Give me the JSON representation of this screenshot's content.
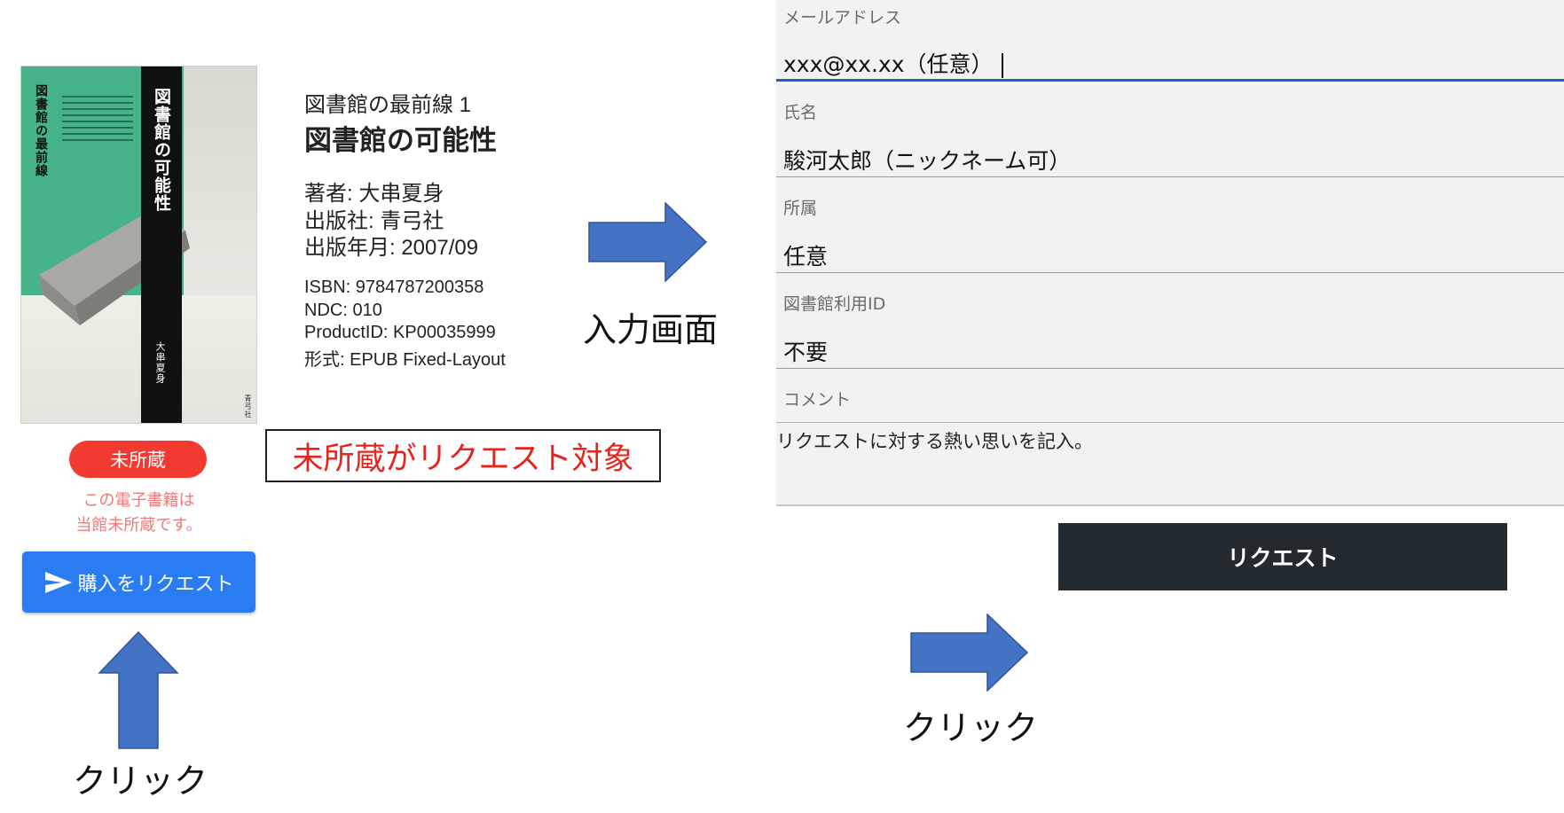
{
  "book": {
    "cover_title": "図書館の可能性",
    "cover_series": "図書館の最前線",
    "cover_author": "大串夏身",
    "cover_publisher": "青弓社",
    "series": "図書館の最前線 1",
    "title": "図書館の可能性",
    "author": "著者: 大串夏身",
    "publisher": "出版社: 青弓社",
    "pub_date": "出版年月: 2007/09",
    "isbn": "ISBN: 9784787200358",
    "ndc": "NDC: 010",
    "product_id": "ProductID: KP00035999",
    "format": "形式: EPUB Fixed-Layout"
  },
  "status": {
    "badge": "未所蔵",
    "note_line1": "この電子書籍は",
    "note_line2": "当館未所蔵です。",
    "request_button": "購入をリクエスト"
  },
  "annotations": {
    "target_note": "未所蔵がリクエスト対象",
    "input_screen": "入力画面",
    "click_left": "クリック",
    "click_right": "クリック"
  },
  "form": {
    "email_label": "メールアドレス",
    "email_value": "xxx@xx.xx（任意）",
    "name_label": "氏名",
    "name_value": "駿河太郎（ニックネーム可）",
    "affiliation_label": "所属",
    "affiliation_value": "任意",
    "library_id_label": "図書館利用ID",
    "library_id_value": "不要",
    "comment_label": "コメント",
    "comment_value": "リクエストに対する熱い思いを記入。",
    "submit_button": "リクエスト"
  },
  "colors": {
    "badge_red": "#f23a30",
    "request_blue": "#2a7cf3",
    "arrow_blue": "#4472c4",
    "submit_dark": "#232a2f",
    "annotation_red": "#e8231d"
  },
  "icons": [
    "send-icon",
    "arrow-right-icon",
    "arrow-up-icon"
  ]
}
